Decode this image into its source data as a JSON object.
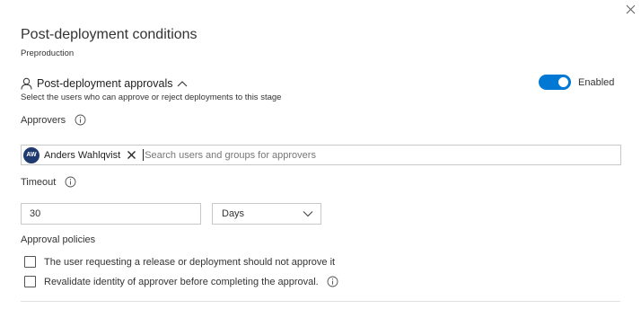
{
  "panel": {
    "title": "Post-deployment conditions",
    "stage": "Preproduction"
  },
  "approvals": {
    "header": "Post-deployment approvals",
    "description": "Select the users who can approve or reject deployments to this stage",
    "toggle_label": "Enabled",
    "toggle_on": true,
    "accent_color": "#0078d4"
  },
  "approvers": {
    "label": "Approvers",
    "chip": {
      "initials": "AW",
      "name": "Anders Wahlqvist"
    },
    "search_placeholder": "Search users and groups for approvers"
  },
  "timeout": {
    "label": "Timeout",
    "value": "30",
    "unit": "Days"
  },
  "policies": {
    "label": "Approval policies",
    "items": [
      {
        "label": "The user requesting a release or deployment should not approve it",
        "checked": false
      },
      {
        "label": "Revalidate identity of approver before completing the approval.",
        "checked": false
      }
    ]
  },
  "icons": {
    "close": "close-icon",
    "person": "person-icon",
    "collapse": "chevron-up-icon",
    "info": "info-icon",
    "remove": "close-icon",
    "dropdown": "chevron-down-icon"
  }
}
